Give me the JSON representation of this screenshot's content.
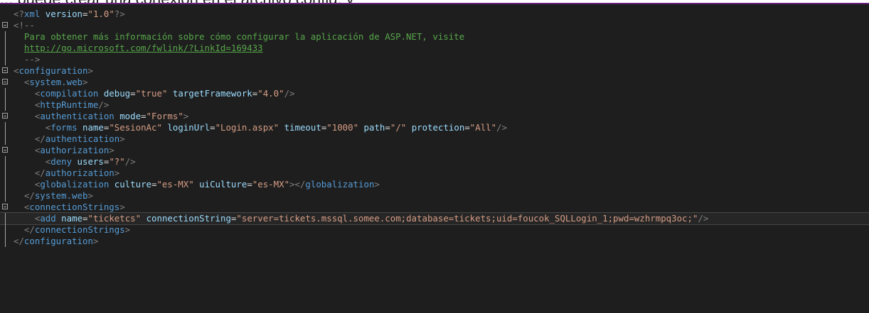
{
  "top_fragment": "... puede crear una conexión en el archivo config, y",
  "editor": {
    "xml_decl": {
      "version_value": "1.0"
    },
    "comment": {
      "open": "<!--",
      "text": "Para obtener más información sobre cómo configurar la aplicación de ASP.NET, visite",
      "link": "http://go.microsoft.com/fwlink/?LinkId=169433",
      "close": "-->"
    },
    "tags": {
      "configuration": "configuration",
      "system_web": "system.web",
      "compilation": "compilation",
      "httpRuntime": "httpRuntime",
      "authentication": "authentication",
      "forms": "forms",
      "authorization": "authorization",
      "deny": "deny",
      "globalization": "globalization",
      "connectionStrings": "connectionStrings",
      "add": "add"
    },
    "attrs": {
      "debug": {
        "name": "debug",
        "value": "true"
      },
      "targetFramework": {
        "name": "targetFramework",
        "value": "4.0"
      },
      "mode": {
        "name": "mode",
        "value": "Forms"
      },
      "forms_name": {
        "name": "name",
        "value": "SesionAc"
      },
      "loginUrl": {
        "name": "loginUrl",
        "value": "Login.aspx"
      },
      "timeout": {
        "name": "timeout",
        "value": "1000"
      },
      "path": {
        "name": "path",
        "value": "/"
      },
      "protection": {
        "name": "protection",
        "value": "All"
      },
      "users": {
        "name": "users",
        "value": "?"
      },
      "culture": {
        "name": "culture",
        "value": "es-MX"
      },
      "uiCulture": {
        "name": "uiCulture",
        "value": "es-MX"
      },
      "add_name": {
        "name": "name",
        "value": "ticketcs"
      },
      "connectionString": {
        "name": "connectionString",
        "value": "server=tickets.mssql.somee.com;database=tickets;uid=foucok_SQLLogin_1;pwd=wzhrmpq3oc;"
      }
    },
    "colors": {
      "background": "#1e1e1e",
      "tag": "#569cd6",
      "attribute": "#9cdcfe",
      "value": "#d69d85",
      "comment": "#57a64a",
      "delimiter": "#808080",
      "accent_border": "#68217a"
    }
  }
}
